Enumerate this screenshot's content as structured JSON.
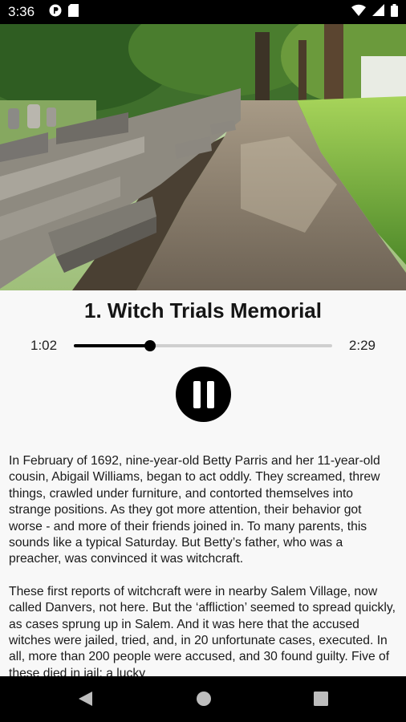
{
  "status": {
    "time": "3:36",
    "icons": [
      "app-notification-icon",
      "sd-card-icon",
      "wifi-icon",
      "signal-icon",
      "battery-icon"
    ]
  },
  "hero_image": {
    "alt": "cemetery-path-photo"
  },
  "track": {
    "title": "1. Witch Trials Memorial",
    "current_time": "1:02",
    "total_time": "2:29",
    "progress": 0.295,
    "state": "pause-icon"
  },
  "content": {
    "paragraphs": [
      "In February of 1692, nine-year-old Betty Parris and her 11-year-old cousin, Abigail Williams, began to act oddly. They screamed, threw things, crawled under furniture, and contorted themselves into strange positions. As they got more attention, their behavior got worse - and more of their friends joined in. To many parents, this sounds like a typical Saturday. But Betty’s father, who was a preacher, was convinced it was witchcraft.",
      "These first reports of witchcraft were in nearby Salem Village, now called Danvers, not here. But the ‘affliction’ seemed to spread quickly, as cases sprung up in Salem. And it was here that the accused witches were jailed, tried, and, in 20 unfortunate cases, executed. In all, more than 200 people were accused, and 30 found guilty. Five of these died in jail; a lucky"
    ]
  },
  "nav": {
    "back": "back-icon",
    "home": "home-icon",
    "recents": "recents-icon"
  },
  "colors": {
    "accent": "#000000",
    "background": "#f8f8f8",
    "track": "#cfcfcf"
  }
}
